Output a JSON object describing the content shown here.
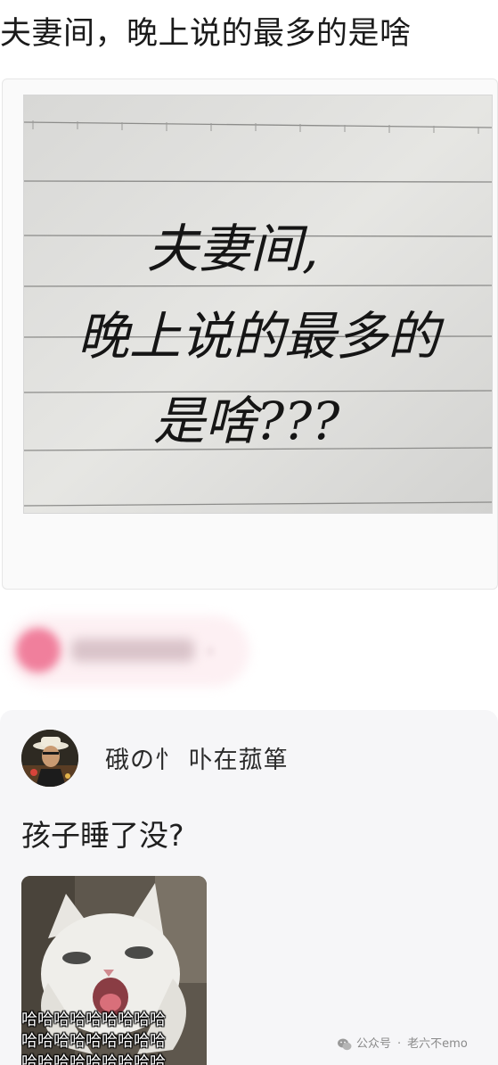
{
  "header": {
    "title": "夫妻间，晚上说的最多的是啥"
  },
  "note_image": {
    "icon": "lined-paper-handwriting-image",
    "lines": [
      "夫妻间,",
      "晚上说的最多的",
      "是啥???"
    ]
  },
  "blurred_author": {
    "icon": "blurred-avatar"
  },
  "post": {
    "avatar_icon": "user-avatar-image",
    "username": "硪の忄 卟在菰箪",
    "text": "孩子睡了没?",
    "image": {
      "icon": "crying-cat-meme-image",
      "captions": [
        "哈哈哈哈哈哈哈哈哈",
        "哈哈哈哈哈哈哈哈哈",
        "哈哈哈哈哈哈哈哈哈"
      ]
    }
  },
  "watermark": {
    "icon": "wechat-logo-icon",
    "source": "公众号",
    "separator": "·",
    "account": "老六不emo"
  },
  "colors": {
    "title_text": "#1a1a1a",
    "post_background": "#f6f6f8",
    "blurred_avatar": "#f07f9c",
    "watermark_text": "#8a8a8a"
  }
}
